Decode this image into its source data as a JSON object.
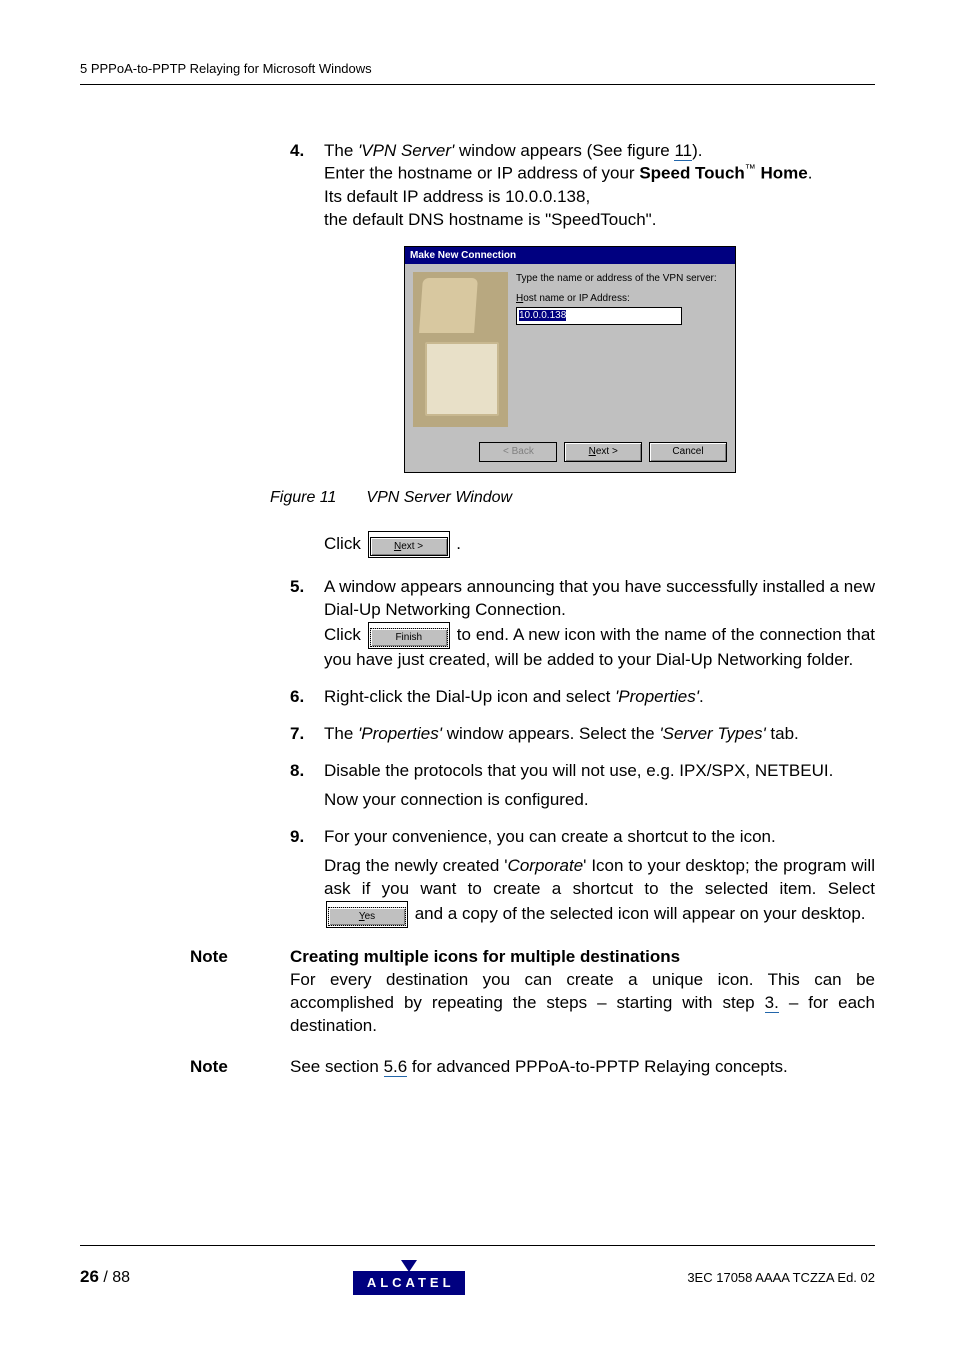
{
  "header": {
    "text": "5   PPPoA-to-PPTP Relaying for Microsoft Windows"
  },
  "step4": {
    "num": "4.",
    "l1a": "The ",
    "l1b": "'VPN Server'",
    "l1c": " window appears (See figure ",
    "figref": "11",
    "l1d": ").",
    "l2a": "Enter the hostname or IP address of your ",
    "l2b": "Speed Touch",
    "tm": "™",
    "l2c": " Home",
    "l2d": ".",
    "l3": "Its default IP address is 10.0.0.138,",
    "l4": "the default DNS hostname is \"SpeedTouch\"."
  },
  "dialog": {
    "title": "Make New Connection",
    "hint": "Type the name or address of the VPN server:",
    "label_pre": "H",
    "label_rest": "ost name or IP Address:",
    "value": "10.0.0.138",
    "back": "< Back",
    "next_u": "N",
    "next_rest": "ext >",
    "cancel": "Cancel"
  },
  "figcap": {
    "num": "Figure 11",
    "text": "VPN Server Window"
  },
  "click_next": {
    "pre": "Click ",
    "btn_u": "N",
    "btn_rest": "ext >",
    "post": " ."
  },
  "step5": {
    "num": "5.",
    "p1": "A window appears announcing that you have successfully installed a new Dial-Up Networking Connection.",
    "p2a": "Click ",
    "btn": "Finish",
    "p2b": " to end. A new icon with the name of the connection that you have just created, will be added to your Dial-Up Networking folder."
  },
  "step6": {
    "num": "6.",
    "a": "Right-click the Dial-Up icon and select ",
    "b": "'Properties'",
    "c": "."
  },
  "step7": {
    "num": "7.",
    "a": "The ",
    "b": "'Properties'",
    "c": " window appears. Select the ",
    "d": "'Server Types'",
    "e": " tab."
  },
  "step8": {
    "num": "8.",
    "p1": "Disable the protocols that you will not use, e.g. IPX/SPX, NETBEUI.",
    "p2": "Now your connection is configured."
  },
  "step9": {
    "num": "9.",
    "p1": "For your convenience, you can create a shortcut to the icon.",
    "p2a": "Drag the newly created '",
    "p2b": "Corporate",
    "p2c": "' Icon to your desktop; the program will ask if you want to create a shortcut to the selected item. Select ",
    "btn_u": "Y",
    "btn_rest": "es",
    "p2d": " and a copy of the selected icon will appear on your desktop."
  },
  "note1": {
    "label": "Note",
    "title": "Creating multiple icons for multiple destinations",
    "body_a": "For every destination you can create a unique icon. This can be accomplished by repeating the steps – starting with step ",
    "ref": "3.",
    "body_b": " – for each destination."
  },
  "note2": {
    "label": "Note",
    "a": "See section ",
    "ref": "5.6",
    "b": " for advanced PPPoA-to-PPTP Relaying concepts."
  },
  "footer": {
    "page": "26",
    "total": " / 88",
    "brand": "ALCATEL",
    "docid": "3EC 17058 AAAA TCZZA Ed. 02"
  }
}
